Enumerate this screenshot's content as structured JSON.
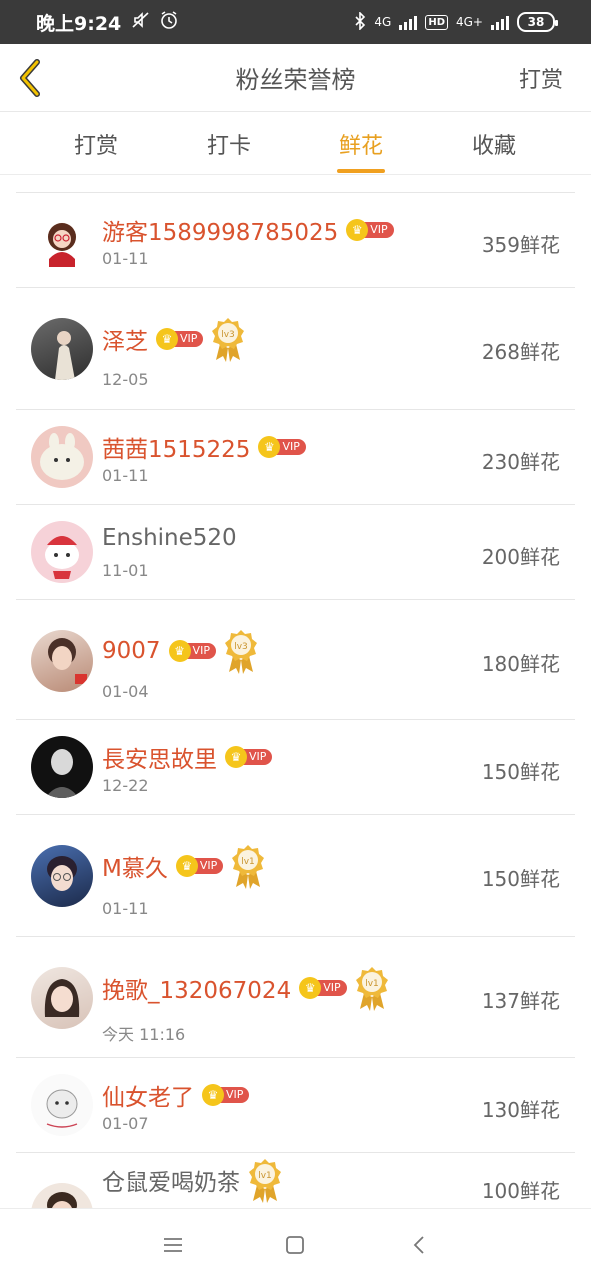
{
  "status_bar": {
    "time": "晚上9:24",
    "network_1": "4G",
    "hd": "HD",
    "network_2": "4G+",
    "battery": "38"
  },
  "header": {
    "title": "粉丝荣誉榜",
    "action": "打赏"
  },
  "tabs": [
    {
      "label": "打赏",
      "active": false
    },
    {
      "label": "打卡",
      "active": false
    },
    {
      "label": "鲜花",
      "active": true
    },
    {
      "label": "收藏",
      "active": false
    }
  ],
  "rows": [
    {
      "name": "游客1589998785025",
      "vip": "VIP",
      "medal": "",
      "date": "01-11",
      "amount": "359鲜花"
    },
    {
      "name": "泽芝",
      "vip": "VIP",
      "medal": "lv3",
      "date": "12-05",
      "amount": "268鲜花"
    },
    {
      "name": "茜茜1515225",
      "vip": "VIP",
      "medal": "",
      "date": "01-11",
      "amount": "230鲜花"
    },
    {
      "name": "Enshine520",
      "vip": "",
      "medal": "",
      "date": "11-01",
      "amount": "200鲜花"
    },
    {
      "name": "9007",
      "vip": "VIP",
      "medal": "lv3",
      "date": "01-04",
      "amount": "180鲜花"
    },
    {
      "name": "長安思故里",
      "vip": "VIP",
      "medal": "",
      "date": "12-22",
      "amount": "150鲜花"
    },
    {
      "name": "M慕久",
      "vip": "VIP",
      "medal": "lv1",
      "date": "01-11",
      "amount": "150鲜花"
    },
    {
      "name": "挽歌_132067024",
      "vip": "VIP",
      "medal": "lv1",
      "date": "今天 11:16",
      "amount": "137鲜花"
    },
    {
      "name": "仙女老了",
      "vip": "VIP",
      "medal": "",
      "date": "01-07",
      "amount": "130鲜花"
    },
    {
      "name": "仓鼠爱喝奶茶",
      "vip": "",
      "medal": "lv1",
      "date": "",
      "amount": "100鲜花"
    }
  ],
  "colors": {
    "accent": "#f0a020",
    "name_red": "#d9532e",
    "vip_red": "#e0544a",
    "vip_gold": "#f5c51b"
  }
}
